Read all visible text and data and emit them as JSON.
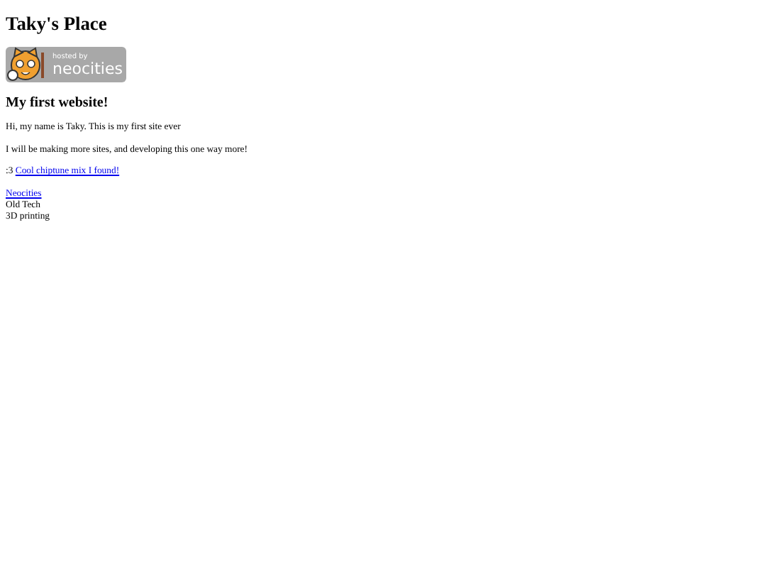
{
  "title": "Taky's Place",
  "badge": {
    "line_1": "hosted by",
    "line_2": "neocities"
  },
  "heading": "My first website!",
  "paragraphs": [
    {
      "parts": [
        {
          "kind": "text",
          "text": "Hi, my name is Taky. This is my first site ever"
        }
      ]
    },
    {
      "parts": [
        {
          "kind": "text",
          "text": "I will be making more sites, and developing this one way more!"
        }
      ]
    },
    {
      "parts": [
        {
          "kind": "text",
          "text": ":3"
        },
        {
          "kind": "link",
          "text": "Cool chiptune mix I found!"
        }
      ]
    }
  ],
  "links": [
    {
      "kind": "link",
      "text": "Neocities"
    },
    {
      "kind": "text",
      "text": "Old Tech"
    },
    {
      "kind": "text",
      "text": "3D printing"
    }
  ]
}
